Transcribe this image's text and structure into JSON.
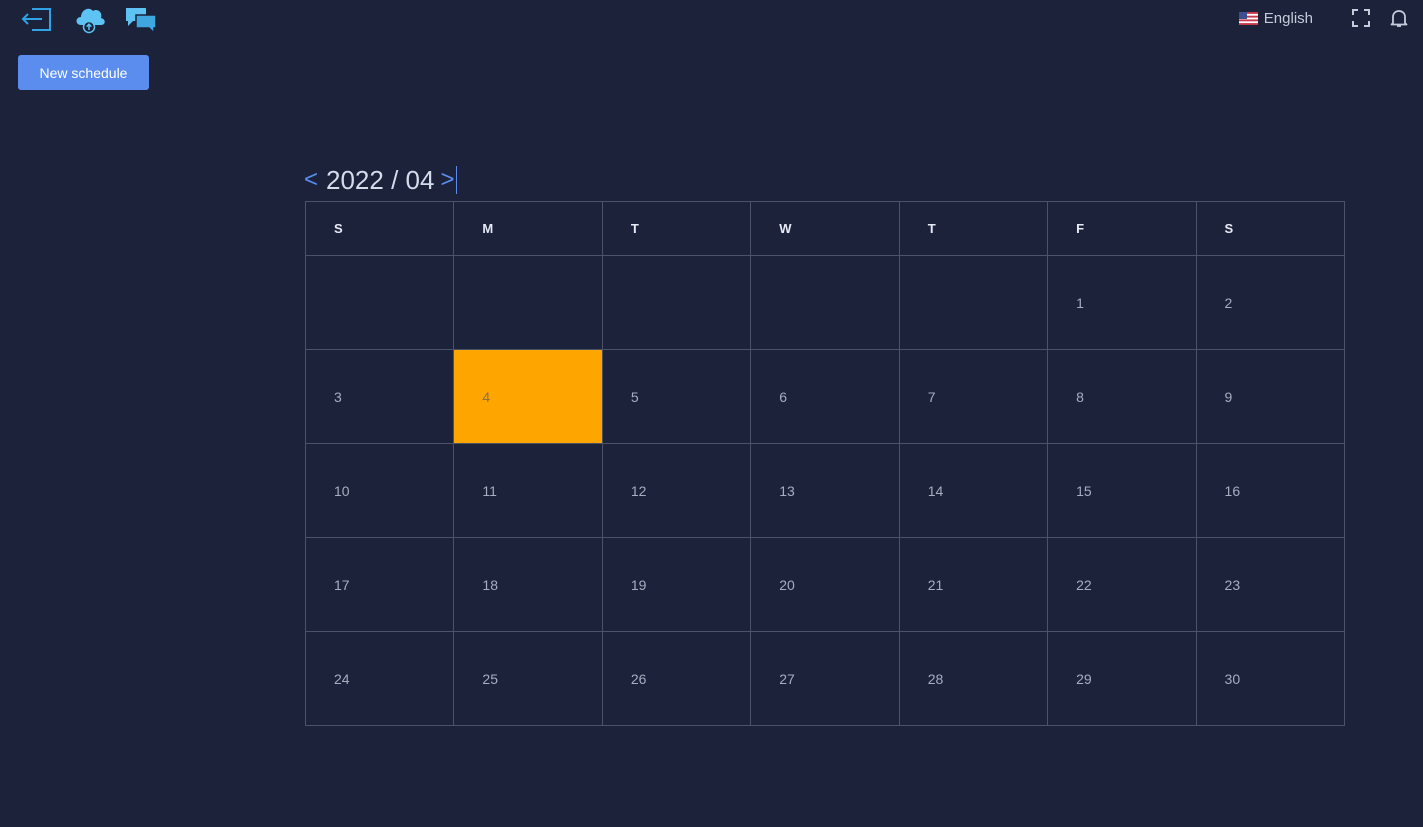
{
  "topbar": {
    "icons": [
      "logout-icon",
      "cloud-upload-icon",
      "chat-icon"
    ],
    "language": {
      "label": "English",
      "flag": "us-flag-icon"
    },
    "tools": [
      "fullscreen-icon",
      "bell-icon"
    ]
  },
  "toolbar": {
    "new_schedule_label": "New schedule"
  },
  "calendar": {
    "prev_label": "<",
    "next_label": ">",
    "month_label": "2022 / 04",
    "weekdays": [
      "S",
      "M",
      "T",
      "W",
      "T",
      "F",
      "S"
    ],
    "weeks": [
      [
        "",
        "",
        "",
        "",
        "",
        "1",
        "2"
      ],
      [
        "3",
        "4",
        "5",
        "6",
        "7",
        "8",
        "9"
      ],
      [
        "10",
        "11",
        "12",
        "13",
        "14",
        "15",
        "16"
      ],
      [
        "17",
        "18",
        "19",
        "20",
        "21",
        "22",
        "23"
      ],
      [
        "24",
        "25",
        "26",
        "27",
        "28",
        "29",
        "30"
      ]
    ],
    "today": "4"
  },
  "colors": {
    "background": "#1b223a",
    "accent": "#5b8def",
    "today_highlight": "#ffa500",
    "grid_line": "#4c5366"
  }
}
